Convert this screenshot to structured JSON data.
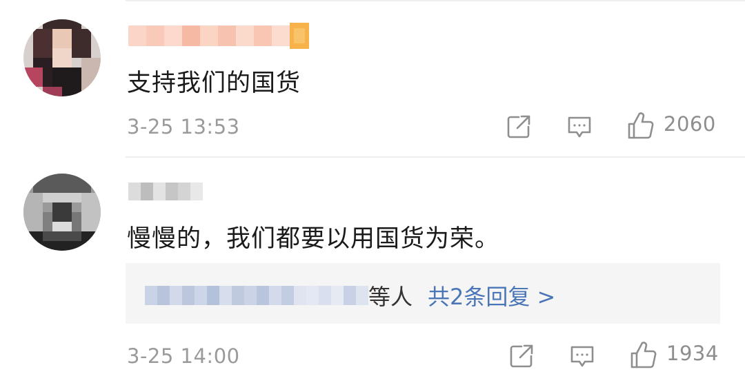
{
  "comments": [
    {
      "text": "支持我们的国货",
      "time": "3-25 13:53",
      "like_count": "2060"
    },
    {
      "text": "慢慢的，我们都要以用国货为荣。",
      "time": "3-25 14:00",
      "like_count": "1934",
      "replies": {
        "suffix": "等人",
        "link": "共2条回复 >"
      }
    }
  ],
  "icons": {
    "share": "share-icon",
    "comment": "comment-icon",
    "like": "thumbs-up-icon"
  },
  "colors": {
    "link": "#4a76b8",
    "meta": "#9a9a9a",
    "text": "#1a1a1a"
  }
}
